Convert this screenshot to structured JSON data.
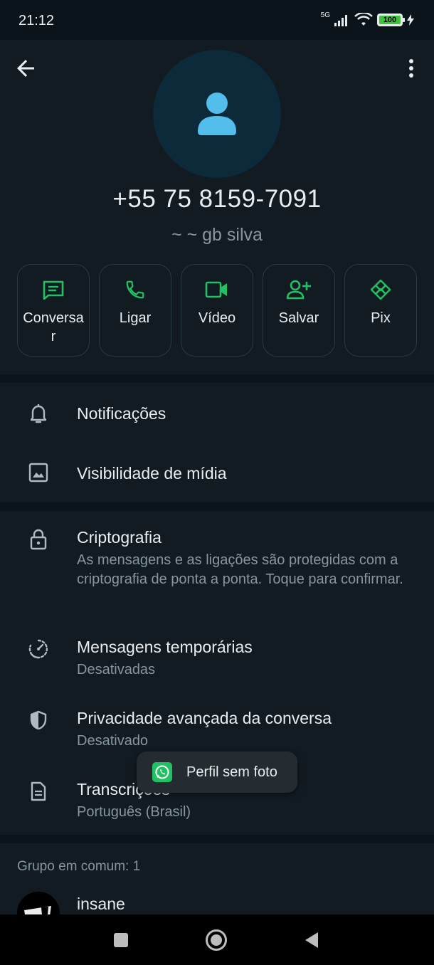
{
  "status_bar": {
    "time": "21:12",
    "network": "5G",
    "battery": "100"
  },
  "contact": {
    "phone": "+55 75 8159-7091",
    "push_name": "~ ~ gb silva"
  },
  "actions": [
    {
      "label": "Conversar",
      "icon": "message-icon"
    },
    {
      "label": "Ligar",
      "icon": "phone-icon"
    },
    {
      "label": "Vídeo",
      "icon": "video-icon"
    },
    {
      "label": "Salvar",
      "icon": "add-contact-icon"
    },
    {
      "label": "Pix",
      "icon": "pix-icon"
    }
  ],
  "settings": {
    "notifications": "Notificações",
    "media_visibility": "Visibilidade de mídia",
    "encryption_title": "Criptografia",
    "encryption_sub": "As mensagens e as ligações são protegidas com a criptografia de ponta a ponta. Toque para confirmar.",
    "disappearing_title": "Mensagens temporárias",
    "disappearing_sub": "Desativadas",
    "privacy_title": "Privacidade avançada da conversa",
    "privacy_sub": "Desativado",
    "transcripts_title": "Transcrições",
    "transcripts_sub": "Português (Brasil)"
  },
  "groups": {
    "header": "Grupo em comum: 1",
    "items": [
      {
        "name": "insane"
      }
    ]
  },
  "toast": {
    "text": "Perfil sem foto"
  },
  "colors": {
    "accent": "#21c063",
    "background": "#0b141a",
    "surface": "#121b22",
    "secondary_text": "#8696a0",
    "avatar_bg": "#0c2a3a",
    "avatar_fg": "#53bdeb"
  }
}
